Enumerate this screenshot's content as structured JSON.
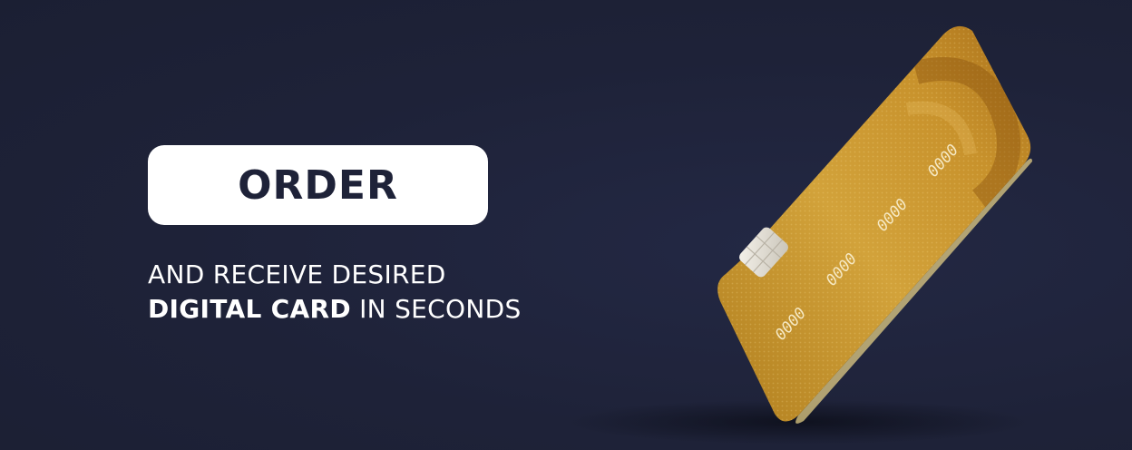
{
  "banner": {
    "button_label": "ORDER",
    "tagline_line1": "AND RECEIVE DESIRED",
    "tagline_bold": "DIGITAL CARD",
    "tagline_rest": " IN SECONDS"
  },
  "card": {
    "number_groups": [
      "0000",
      "0000",
      "0000",
      "0000"
    ],
    "color": "#c9962b"
  },
  "colors": {
    "background": "#1e2238",
    "button_bg": "#ffffff",
    "button_text": "#1e2238",
    "text": "#ffffff"
  }
}
